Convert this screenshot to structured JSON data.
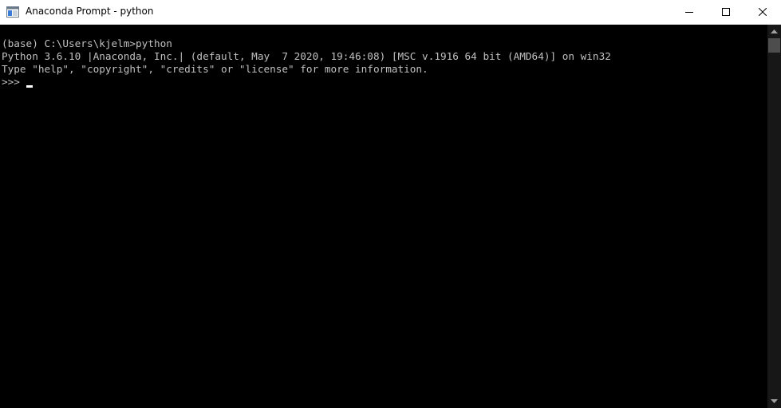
{
  "window": {
    "title": "Anaconda Prompt - python",
    "icon": "console-window-icon",
    "controls": {
      "minimize_icon": "minimize-icon",
      "maximize_icon": "maximize-icon",
      "close_icon": "close-icon"
    }
  },
  "console": {
    "lines": [
      "(base) C:\\Users\\kjelm>python",
      "Python 3.6.10 |Anaconda, Inc.| (default, May  7 2020, 19:46:08) [MSC v.1916 64 bit (AMD64)] on win32",
      "Type \"help\", \"copyright\", \"credits\" or \"license\" for more information.",
      ">>> "
    ],
    "colors": {
      "background": "#000000",
      "text": "#c0c0c0",
      "cursor": "#ffffff"
    }
  },
  "scrollbar": {
    "up_icon": "scroll-up-arrow-icon",
    "down_icon": "scroll-down-arrow-icon"
  }
}
